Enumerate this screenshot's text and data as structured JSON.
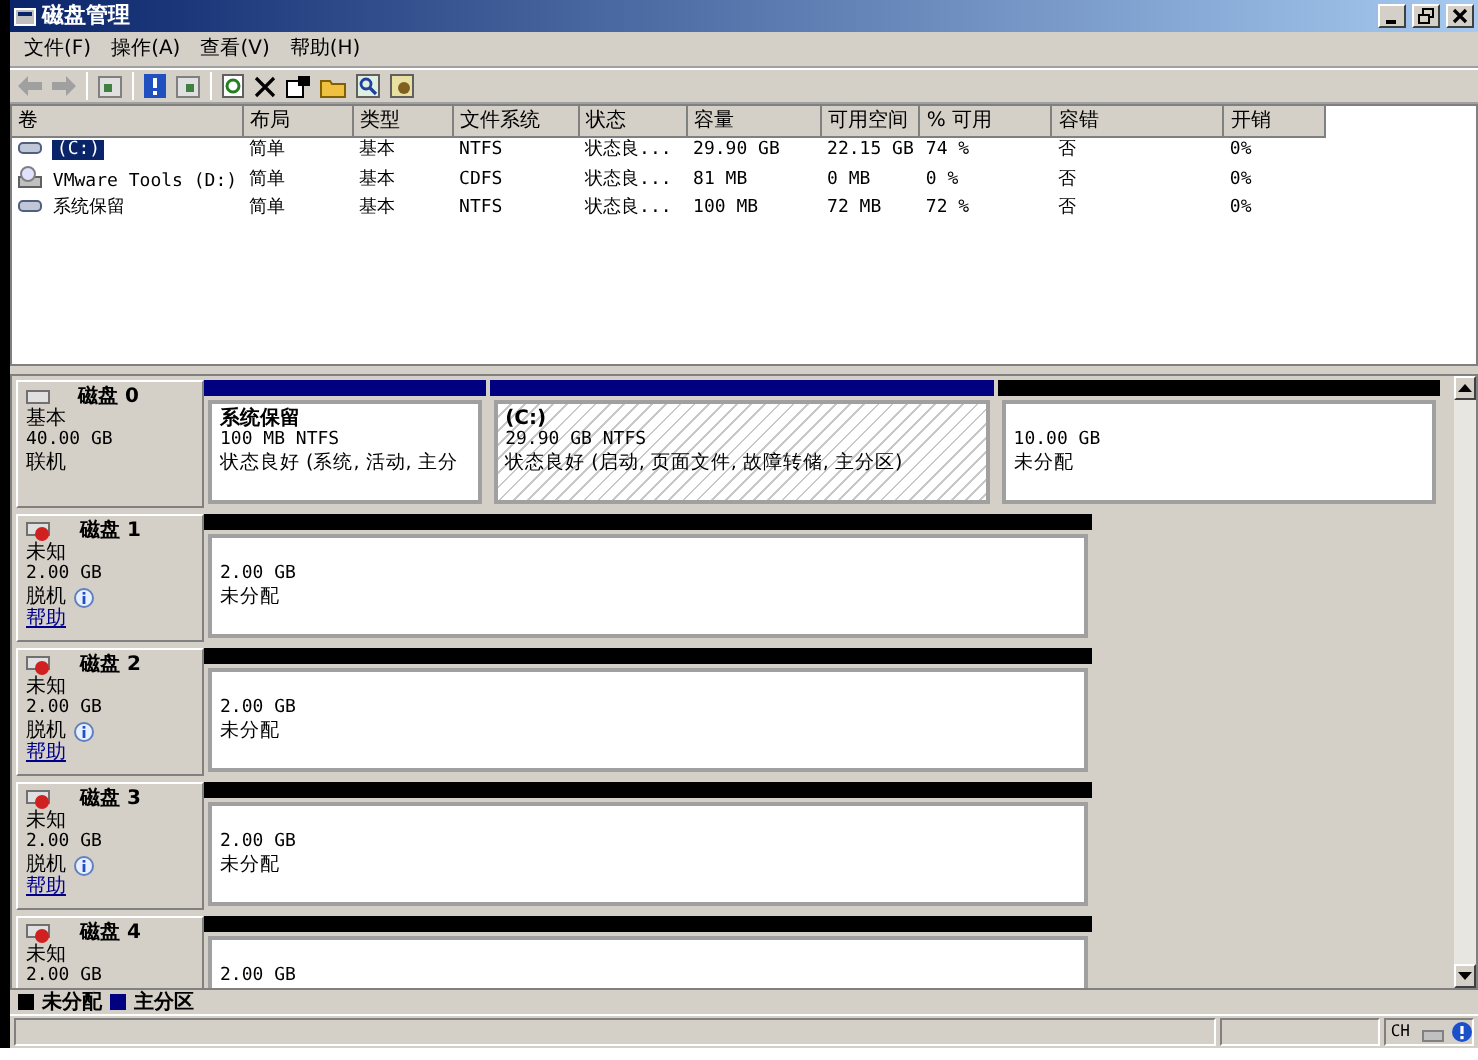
{
  "window": {
    "title": "磁盘管理"
  },
  "menu": [
    "文件(F)",
    "操作(A)",
    "查看(V)",
    "帮助(H)"
  ],
  "volumes": {
    "columns": [
      "卷",
      "布局",
      "类型",
      "文件系统",
      "状态",
      "容量",
      "可用空间",
      "% 可用",
      "容错",
      "开销"
    ],
    "rows": [
      {
        "kind": "disk",
        "selected": true,
        "cells": [
          "(C:)",
          "简单",
          "基本",
          "NTFS",
          "状态良...",
          "29.90 GB",
          "22.15 GB",
          "74 %",
          "否",
          "0%"
        ]
      },
      {
        "kind": "cdrom",
        "selected": false,
        "cells": [
          "VMware Tools (D:)",
          "简单",
          "基本",
          "CDFS",
          "状态良...",
          "81 MB",
          "0 MB",
          "0 %",
          "否",
          "0%"
        ]
      },
      {
        "kind": "disk",
        "selected": false,
        "cells": [
          "系统保留",
          "简单",
          "基本",
          "NTFS",
          "状态良...",
          "100 MB",
          "72 MB",
          "72 %",
          "否",
          "0%"
        ]
      }
    ]
  },
  "disks": [
    {
      "name": "磁盘 0",
      "type": "基本",
      "size": "40.00 GB",
      "status": "联机",
      "online": true,
      "partitions": [
        {
          "kind": "primary",
          "selected": false,
          "name": "系统保留",
          "size": "100 MB NTFS",
          "status": "状态良好 (系统, 活动, 主分"
        },
        {
          "kind": "primary",
          "selected": true,
          "name": "(C:)",
          "size": "29.90 GB NTFS",
          "status": "状态良好 (启动, 页面文件, 故障转储, 主分区)"
        },
        {
          "kind": "unallocated",
          "selected": false,
          "size": "10.00 GB",
          "status": "未分配"
        }
      ]
    },
    {
      "name": "磁盘 1",
      "type": "未知",
      "size": "2.00 GB",
      "status": "脱机",
      "online": false,
      "help": "帮助",
      "partitions": [
        {
          "kind": "unallocated",
          "selected": false,
          "size": "2.00 GB",
          "status": "未分配"
        }
      ]
    },
    {
      "name": "磁盘 2",
      "type": "未知",
      "size": "2.00 GB",
      "status": "脱机",
      "online": false,
      "help": "帮助",
      "partitions": [
        {
          "kind": "unallocated",
          "selected": false,
          "size": "2.00 GB",
          "status": "未分配"
        }
      ]
    },
    {
      "name": "磁盘 3",
      "type": "未知",
      "size": "2.00 GB",
      "status": "脱机",
      "online": false,
      "help": "帮助",
      "partitions": [
        {
          "kind": "unallocated",
          "selected": false,
          "size": "2.00 GB",
          "status": "未分配"
        }
      ]
    },
    {
      "name": "磁盘 4",
      "type": "未知",
      "size": "2.00 GB",
      "online": false,
      "partitions": [
        {
          "kind": "unallocated",
          "selected": false,
          "size": "2.00 GB"
        }
      ]
    }
  ],
  "legend": [
    {
      "label": "未分配",
      "color": "#000000"
    },
    {
      "label": "主分区",
      "color": "#000080"
    }
  ],
  "status_bar": {
    "language": "CH"
  }
}
